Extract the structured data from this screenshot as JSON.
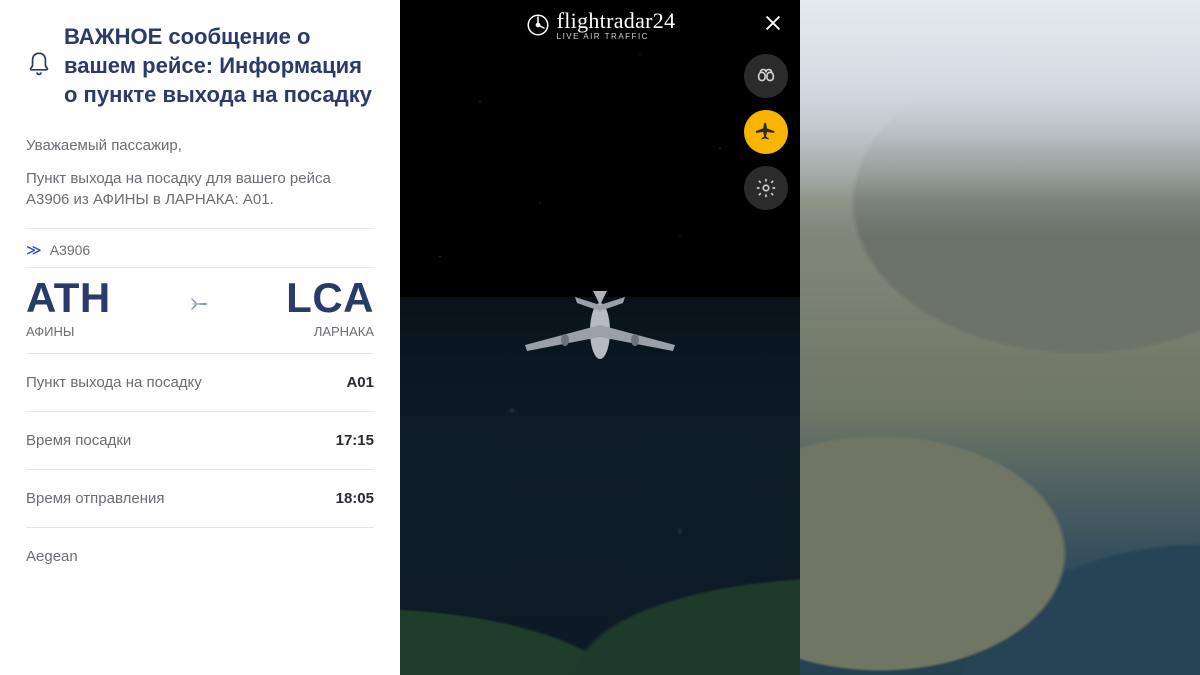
{
  "notice": {
    "title": "ВАЖНОЕ сообщение о вашем рейсе: Информация о пункте выхода на посадку",
    "greeting": "Уважаемый пассажир,",
    "body": "Пункт выхода на посадку для вашего рейса A3906 из АФИНЫ в ЛАРНАКА: A01.",
    "flight_number": "A3906",
    "origin_code": "ATH",
    "origin_city": "АФИНЫ",
    "dest_code": "LCA",
    "dest_city": "ЛАРНАКА",
    "rows": [
      {
        "label": "Пункт выхода на посадку",
        "value": "A01"
      },
      {
        "label": "Время посадки",
        "value": "17:15"
      },
      {
        "label": "Время отправления",
        "value": "18:05"
      }
    ],
    "airline": "Aegean"
  },
  "fr24": {
    "brand": "flightradar24",
    "tagline": "LIVE AIR TRAFFIC"
  }
}
